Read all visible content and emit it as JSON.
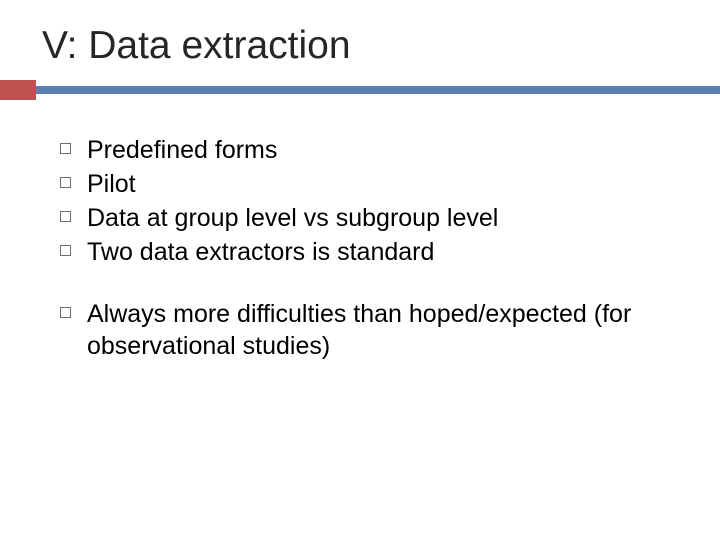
{
  "title": "V: Data extraction",
  "bullets_group1": [
    "Predefined forms",
    "Pilot",
    "Data at group level vs subgroup level",
    "Two data extractors is standard"
  ],
  "bullets_group2": [
    "Always more difficulties than hoped/expected (for observational studies)"
  ]
}
